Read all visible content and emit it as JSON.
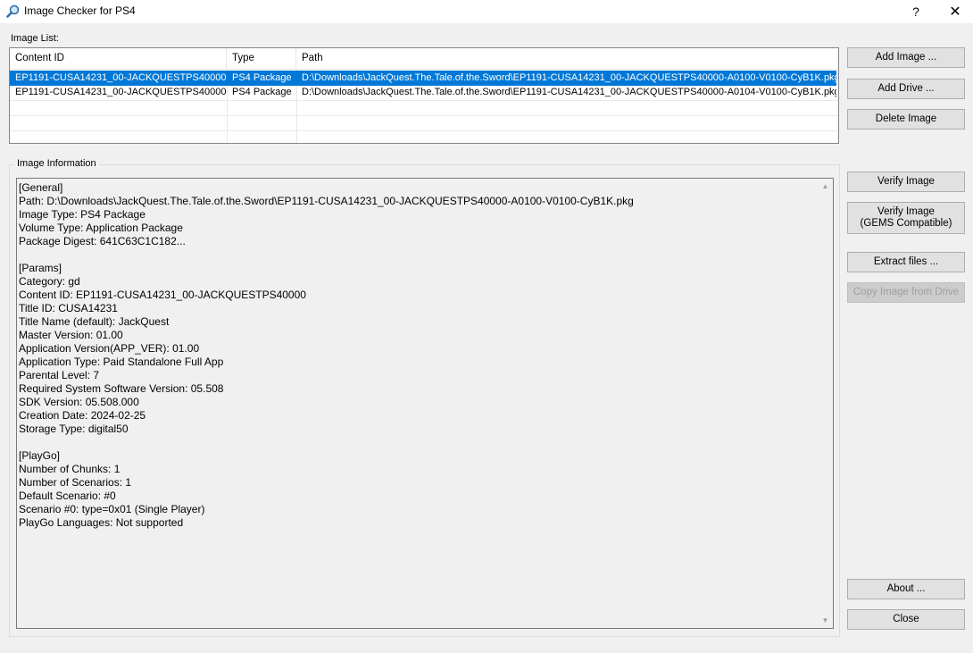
{
  "window": {
    "title": "Image Checker for PS4",
    "help_glyph": "?",
    "close_glyph": "✕"
  },
  "image_list": {
    "label": "Image List:",
    "columns": [
      "Content ID",
      "Type",
      "Path"
    ],
    "rows": [
      {
        "content_id": "EP1191-CUSA14231_00-JACKQUESTPS40000",
        "type": "PS4 Package",
        "path": "D:\\Downloads\\JackQuest.The.Tale.of.the.Sword\\EP1191-CUSA14231_00-JACKQUESTPS40000-A0100-V0100-CyB1K.pkg",
        "selected": true
      },
      {
        "content_id": "EP1191-CUSA14231_00-JACKQUESTPS40000",
        "type": "PS4 Package",
        "path": "D:\\Downloads\\JackQuest.The.Tale.of.the.Sword\\EP1191-CUSA14231_00-JACKQUESTPS40000-A0104-V0100-CyB1K.pkg",
        "selected": false
      }
    ]
  },
  "image_info": {
    "label": "Image Information",
    "lines": [
      "[General]",
      "Path: D:\\Downloads\\JackQuest.The.Tale.of.the.Sword\\EP1191-CUSA14231_00-JACKQUESTPS40000-A0100-V0100-CyB1K.pkg",
      "Image Type: PS4 Package",
      "Volume Type: Application Package",
      "Package Digest: 641C63C1C182...",
      "",
      "[Params]",
      "Category: gd",
      "Content ID: EP1191-CUSA14231_00-JACKQUESTPS40000",
      "Title ID: CUSA14231",
      "Title Name (default): JackQuest",
      "Master Version: 01.00",
      "Application Version(APP_VER): 01.00",
      "Application Type: Paid Standalone Full App",
      "Parental Level: 7",
      "Required System Software Version: 05.508",
      "SDK Version: 05.508.000",
      "Creation Date: 2024-02-25",
      "Storage Type: digital50",
      "",
      "[PlayGo]",
      "Number of Chunks: 1",
      "Number of Scenarios: 1",
      "Default Scenario: #0",
      "Scenario #0: type=0x01 (Single Player)",
      "PlayGo Languages: Not supported"
    ]
  },
  "buttons": {
    "add_image": "Add Image ...",
    "add_drive": "Add Drive ...",
    "delete_image": "Delete Image",
    "verify_image": "Verify Image",
    "verify_gems_line1": "Verify Image",
    "verify_gems_line2": "(GEMS Compatible)",
    "extract_files": "Extract files ...",
    "copy_image": "Copy Image from Drive",
    "about": "About ...",
    "close": "Close"
  },
  "colors": {
    "selection": "#0078d7",
    "window_bg": "#f0f0f0"
  }
}
